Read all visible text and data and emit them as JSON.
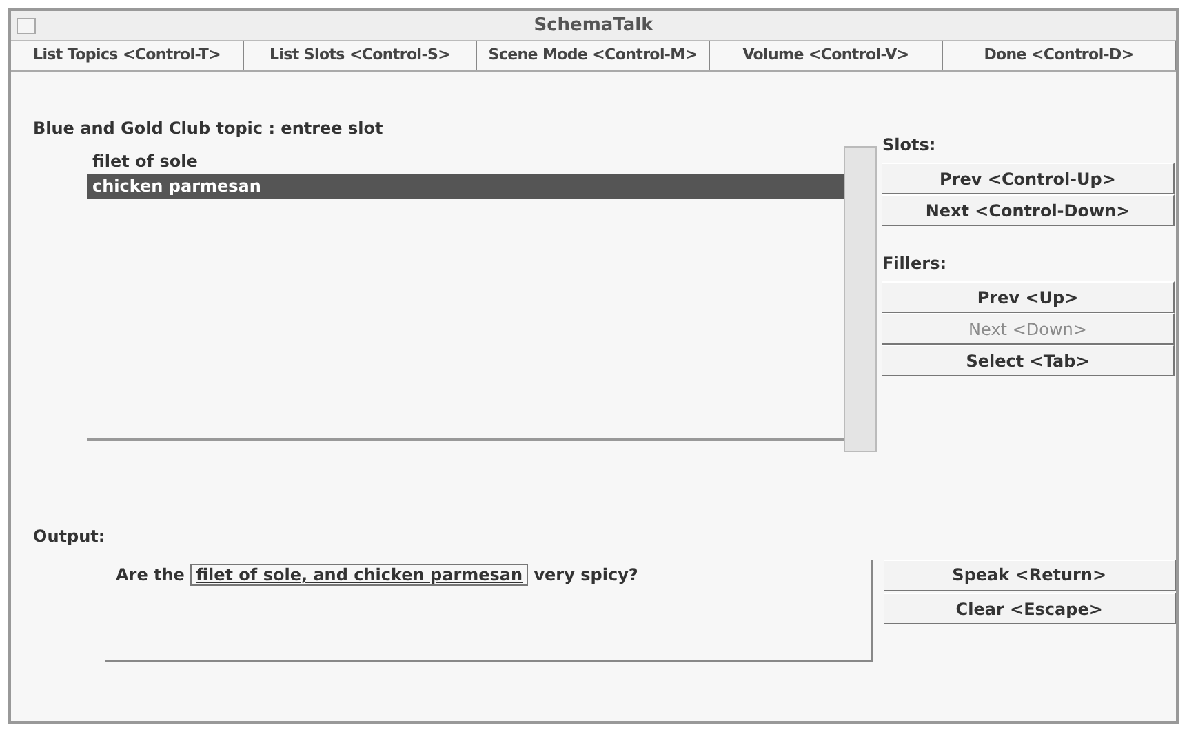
{
  "window": {
    "title": "SchemaTalk"
  },
  "menu": [
    {
      "label": "List Topics <Control-T>"
    },
    {
      "label": "List Slots <Control-S>"
    },
    {
      "label": "Scene Mode <Control-M>"
    },
    {
      "label": "Volume <Control-V>"
    },
    {
      "label": "Done <Control-D>"
    }
  ],
  "heading": "Blue and Gold Club topic :  entree slot",
  "list": [
    {
      "label": "filet of sole",
      "selected": false
    },
    {
      "label": "chicken parmesan",
      "selected": true
    }
  ],
  "slots": {
    "label": "Slots:",
    "buttons": [
      {
        "label": "Prev <Control-Up>",
        "disabled": false
      },
      {
        "label": "Next <Control-Down>",
        "disabled": false
      }
    ]
  },
  "fillers": {
    "label": "Fillers:",
    "buttons": [
      {
        "label": "Prev <Up>",
        "disabled": false
      },
      {
        "label": "Next <Down>",
        "disabled": true
      },
      {
        "label": "Select <Tab>",
        "disabled": false
      }
    ]
  },
  "output": {
    "label": "Output:",
    "prefix": "Are the",
    "highlight": "filet of sole, and chicken parmesan",
    "suffix": "very spicy?"
  },
  "output_buttons": [
    {
      "label": "Speak <Return>",
      "disabled": false
    },
    {
      "label": "Clear <Escape>",
      "disabled": false
    }
  ]
}
